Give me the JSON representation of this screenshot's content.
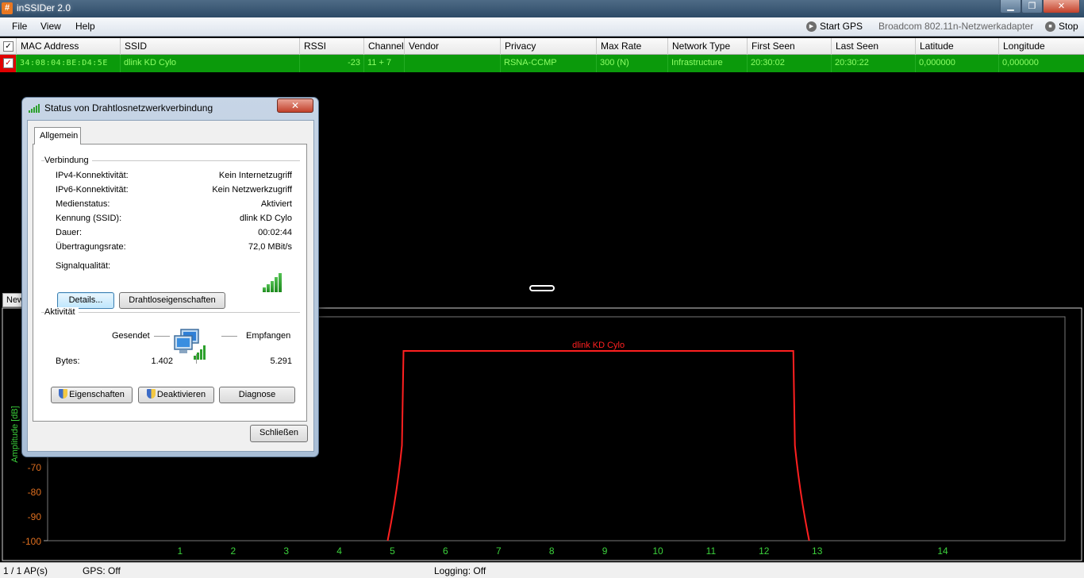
{
  "window": {
    "title": "inSSIDer 2.0",
    "app_icon": "#",
    "minimize_symbol": "▁",
    "maximize_symbol": "❐",
    "close_symbol": "✕"
  },
  "menu": {
    "file": "File",
    "view": "View",
    "help": "Help",
    "start_gps": "Start GPS",
    "adapter": "Broadcom 802.11n-Netzwerkadapter",
    "stop": "Stop"
  },
  "table": {
    "columns": [
      "MAC Address",
      "SSID",
      "RSSI",
      "Channel",
      "Vendor",
      "Privacy",
      "Max Rate",
      "Network Type",
      "First Seen",
      "Last Seen",
      "Latitude",
      "Longitude"
    ],
    "rows": [
      {
        "mac": "34:08:04:BE:D4:5E",
        "ssid": "dlink KD Cylo",
        "rssi": "-23",
        "channel": "11 + 7",
        "vendor": "",
        "privacy": "RSNA-CCMP",
        "max_rate": "300 (N)",
        "network_type": "Infrastructure",
        "first_seen": "20:30:02",
        "last_seen": "20:30:22",
        "latitude": "0,000000",
        "longitude": "0,000000"
      }
    ]
  },
  "graph_tab": "News",
  "graph": {
    "ylabel": "Amplitude [dB]",
    "y_ticks": [
      "-70",
      "-80",
      "-90",
      "-100"
    ],
    "x_ticks": [
      "1",
      "2",
      "3",
      "4",
      "5",
      "6",
      "7",
      "8",
      "9",
      "10",
      "11",
      "12",
      "13",
      "14"
    ],
    "network_label": "dlink KD Cylo",
    "network_color": "#ff2020",
    "network_channel_span": [
      5,
      13
    ],
    "network_amplitude_dB": -23
  },
  "status": {
    "ap_count": "1 / 1 AP(s)",
    "gps": "GPS: Off",
    "logging": "Logging: Off"
  },
  "dialog": {
    "title": "Status von Drahtlosnetzwerkverbindung",
    "close_symbol": "✕",
    "tab": "Allgemein",
    "connection_heading": "Verbindung",
    "fields": [
      {
        "label": "IPv4-Konnektivität:",
        "value": "Kein Internetzugriff"
      },
      {
        "label": "IPv6-Konnektivität:",
        "value": "Kein Netzwerkzugriff"
      },
      {
        "label": "Medienstatus:",
        "value": "Aktiviert"
      },
      {
        "label": "Kennung (SSID):",
        "value": "dlink KD Cylo"
      },
      {
        "label": "Dauer:",
        "value": "00:02:44"
      },
      {
        "label": "Übertragungsrate:",
        "value": "72,0 MBit/s"
      }
    ],
    "signal_label": "Signalqualität:",
    "details_button": "Details...",
    "wireless_props_button": "Drahtloseigenschaften",
    "activity_heading": "Aktivität",
    "sent_label": "Gesendet",
    "received_label": "Empfangen",
    "bytes_label": "Bytes:",
    "bytes_sent": "1.402",
    "bytes_received": "5.291",
    "properties_button": "Eigenschaften",
    "disable_button": "Deaktivieren",
    "diagnose_button": "Diagnose",
    "close_button": "Schließen"
  }
}
